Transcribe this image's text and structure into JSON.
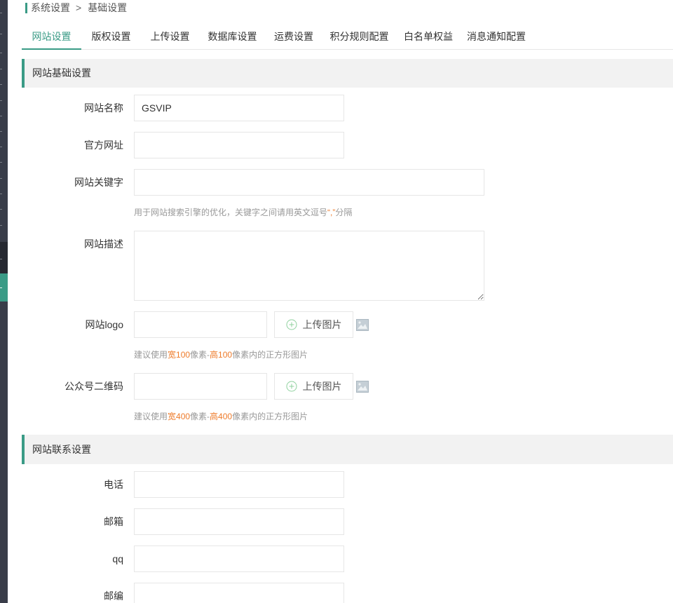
{
  "colors": {
    "accent": "#3a9b86",
    "highlight": "#ee7b2a",
    "sidebar": "#393d49"
  },
  "breadcrumb": {
    "parent": "系统设置",
    "separator": ">",
    "current": "基础设置"
  },
  "tabs": [
    {
      "label": "网站设置",
      "active": true
    },
    {
      "label": "版权设置",
      "active": false
    },
    {
      "label": "上传设置",
      "active": false
    },
    {
      "label": "数据库设置",
      "active": false
    },
    {
      "label": "运费设置",
      "active": false
    },
    {
      "label": "积分规则配置",
      "active": false
    },
    {
      "label": "白名单权益",
      "active": false
    },
    {
      "label": "消息通知配置",
      "active": false
    }
  ],
  "basic_section": {
    "title": "网站基础设置",
    "site_name": {
      "label": "网站名称",
      "value": "GSVIP"
    },
    "official_url": {
      "label": "官方网址",
      "value": ""
    },
    "keywords": {
      "label": "网站关键字",
      "value": "",
      "help": {
        "before": "用于网站搜索引擎的优化，关键字之间请用英文逗号",
        "highlight": "“,”",
        "after": "分隔"
      }
    },
    "description": {
      "label": "网站描述",
      "value": ""
    },
    "logo": {
      "label": "网站logo",
      "value": "",
      "upload_label": "上传图片",
      "upload_icon": "plus-circle-icon",
      "preview_icon": "image-icon",
      "help": {
        "prefix": "建议使用",
        "width": "宽100",
        "mid": "像素-",
        "height": "高100",
        "suffix": "像素内的正方形图片"
      }
    },
    "qrcode": {
      "label": "公众号二维码",
      "value": "",
      "upload_label": "上传图片",
      "upload_icon": "plus-circle-icon",
      "preview_icon": "image-icon",
      "help": {
        "prefix": "建议使用",
        "width": "宽400",
        "mid": "像素-",
        "height": "高400",
        "suffix": "像素内的正方形图片"
      }
    }
  },
  "contact_section": {
    "title": "网站联系设置",
    "phone": {
      "label": "电话",
      "value": ""
    },
    "email": {
      "label": "邮箱",
      "value": ""
    },
    "qq": {
      "label": "qq",
      "value": ""
    },
    "zip": {
      "label": "邮编",
      "value": ""
    }
  }
}
